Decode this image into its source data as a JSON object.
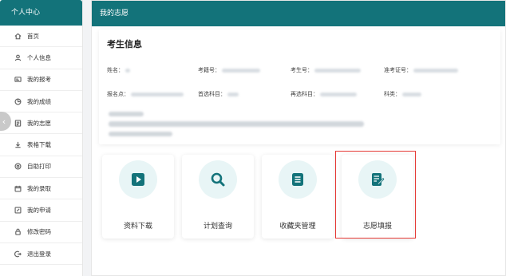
{
  "sidebar": {
    "title": "个人中心",
    "items": [
      {
        "label": "首页",
        "icon": "home-icon"
      },
      {
        "label": "个人信息",
        "icon": "user-icon"
      },
      {
        "label": "我的报考",
        "icon": "id-card-icon"
      },
      {
        "label": "我的成绩",
        "icon": "pie-chart-icon"
      },
      {
        "label": "我的志愿",
        "icon": "form-icon"
      },
      {
        "label": "表格下载",
        "icon": "download-icon"
      },
      {
        "label": "自助打印",
        "icon": "printer-icon"
      },
      {
        "label": "我的录取",
        "icon": "calendar-icon"
      },
      {
        "label": "我的申请",
        "icon": "edit-icon"
      },
      {
        "label": "修改密码",
        "icon": "lock-icon"
      },
      {
        "label": "退出登录",
        "icon": "logout-icon"
      }
    ]
  },
  "collapse_button": "‹",
  "main": {
    "title": "我的志愿",
    "panel_title": "考生信息",
    "fields": {
      "name_label": "姓名：",
      "exam_no_label": "考籍号：",
      "candidate_no_label": "考生号：",
      "admission_no_label": "准考证号：",
      "site_label": "报名点：",
      "first_subject_label": "首选科目：",
      "second_subject_label": "再选科目：",
      "category_label": "科类："
    }
  },
  "cards": [
    {
      "label": "资料下载",
      "icon": "play-icon"
    },
    {
      "label": "计划查询",
      "icon": "search-icon"
    },
    {
      "label": "收藏夹管理",
      "icon": "list-icon"
    },
    {
      "label": "志愿填报",
      "icon": "fill-form-icon"
    }
  ],
  "colors": {
    "primary": "#13737a",
    "icon_bg": "#e8f5f6",
    "highlight": "#e53935"
  }
}
